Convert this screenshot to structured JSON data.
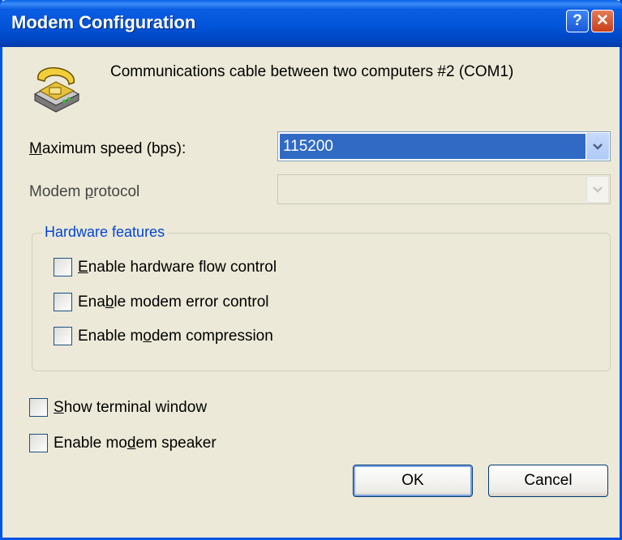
{
  "window": {
    "title": "Modem Configuration"
  },
  "titlebar": {
    "help_label": "?",
    "close_label": "✕"
  },
  "header": {
    "device_name": "Communications cable between two computers #2 (COM1)"
  },
  "max_speed": {
    "label_prefix": "",
    "label_accel": "M",
    "label_rest": "aximum speed (bps):",
    "value": "115200"
  },
  "protocol": {
    "label_prefix": "Modem ",
    "label_accel": "p",
    "label_rest": "rotocol",
    "value": ""
  },
  "hardware": {
    "group_title": "Hardware features",
    "items": [
      {
        "prefix": "",
        "accel": "E",
        "rest": "nable hardware flow control",
        "checked": false
      },
      {
        "prefix": "Ena",
        "accel": "b",
        "rest": "le modem error control",
        "checked": false
      },
      {
        "prefix": "Enable m",
        "accel": "o",
        "rest": "dem compression",
        "checked": false
      }
    ]
  },
  "options": [
    {
      "prefix": "",
      "accel": "S",
      "rest": "how terminal window",
      "checked": false
    },
    {
      "prefix": "Enable mo",
      "accel": "d",
      "rest": "em speaker",
      "checked": false
    }
  ],
  "buttons": {
    "ok": "OK",
    "cancel": "Cancel"
  },
  "colors": {
    "title_bar": "#0054e3",
    "selection": "#316ac5",
    "dialog_bg": "#ece9d8",
    "group_title": "#0046d5"
  },
  "icons": {
    "device": "telephone-modem-icon",
    "dropdown": "chevron-down-icon",
    "help": "help-icon",
    "close": "close-icon"
  }
}
